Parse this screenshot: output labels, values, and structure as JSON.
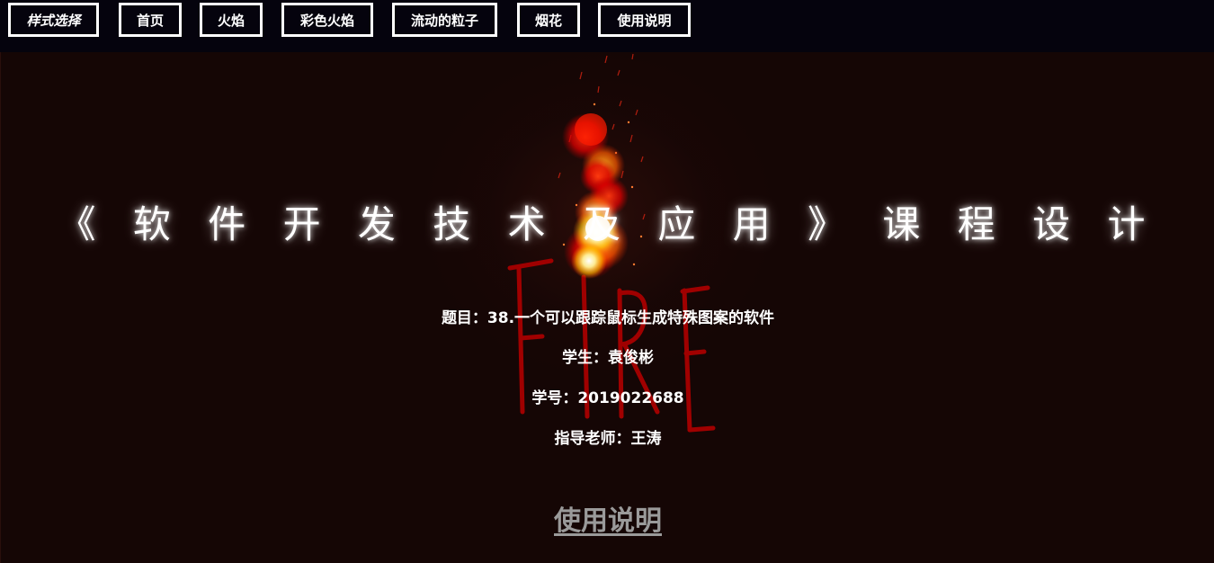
{
  "nav": {
    "style_select": "样式选择",
    "home": "首页",
    "flame": "火焰",
    "color_flame": "彩色火焰",
    "flowing_particles": "流动的粒子",
    "fireworks": "烟花",
    "instructions": "使用说明"
  },
  "main": {
    "title": "《 软 件 开 发 技 术 及 应 用 》 课 程 设 计",
    "topic": "题目：38.一个可以跟踪鼠标生成特殊图案的软件",
    "student": "学生：袁俊彬",
    "student_id": "学号：2019022688",
    "advisor": "指导老师：王涛",
    "help_link": "使用说明"
  },
  "decoration": {
    "fire_word": "FIRE"
  },
  "colors": {
    "background": "#150605",
    "topbar": "#05030d",
    "fire_text": "#a00000",
    "help_link": "#9a9a9a"
  }
}
